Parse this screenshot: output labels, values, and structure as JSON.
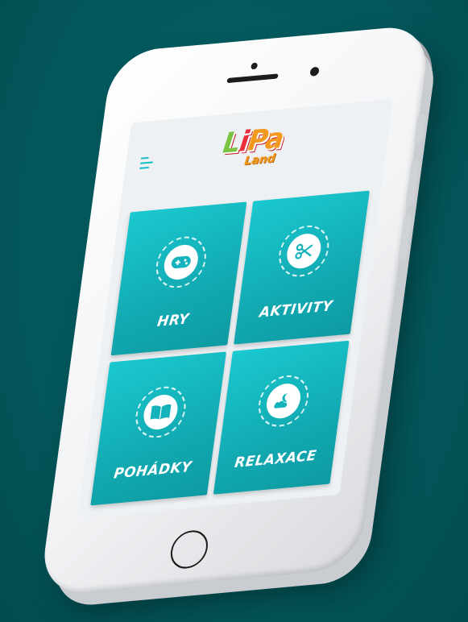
{
  "app": {
    "logo_main": [
      "L",
      "i",
      "Pa"
    ],
    "logo_sub": "Land"
  },
  "tiles": [
    {
      "label": "HRY",
      "icon": "gamepad-icon"
    },
    {
      "label": "AKTIVITY",
      "icon": "scissors-icon"
    },
    {
      "label": "POHÁDKY",
      "icon": "book-icon"
    },
    {
      "label": "RELAXACE",
      "icon": "moon-cloud-icon"
    }
  ],
  "colors": {
    "background": "#02585c",
    "tile": "#14b3bb",
    "menu": "#1dbfc7",
    "logo_red": "#e9303a",
    "logo_green": "#7cc242",
    "logo_orange": "#f39a1e"
  }
}
